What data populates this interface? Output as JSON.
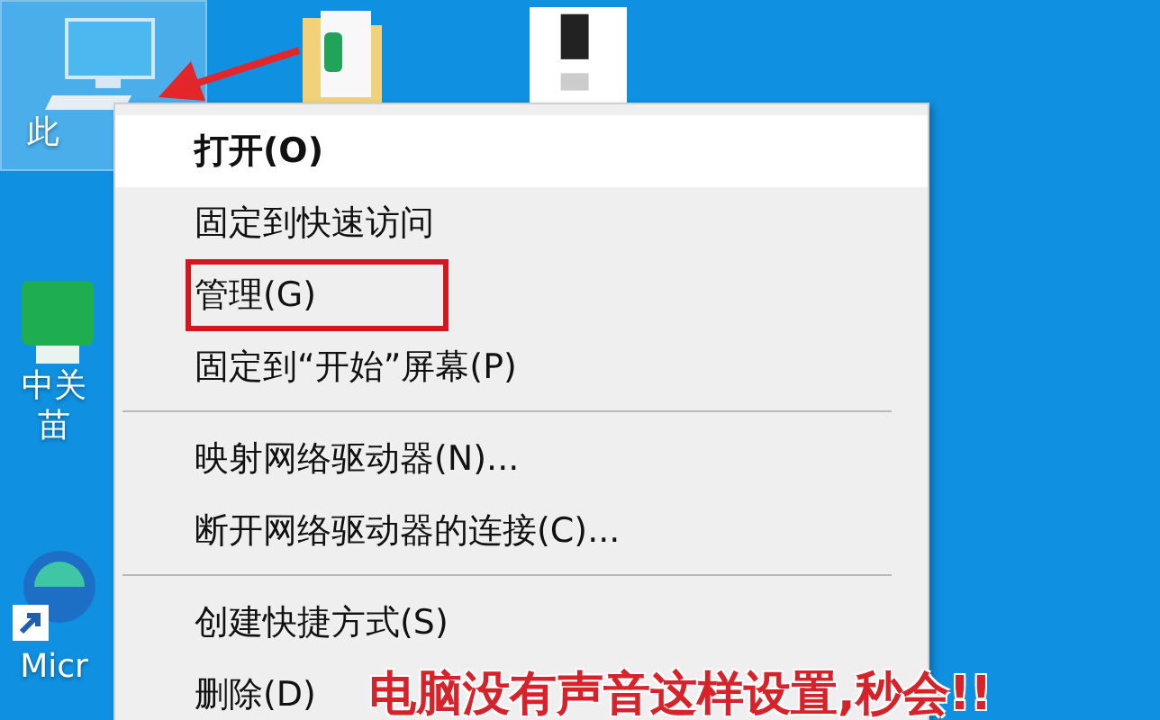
{
  "desktop_icons": [
    {
      "kind": "computer",
      "lines": [
        "此"
      ],
      "selected": true
    },
    {
      "kind": "folder",
      "selected": false
    },
    {
      "kind": "document",
      "selected": false
    },
    {
      "kind": "app",
      "lines": [
        "中关",
        "苗"
      ],
      "selected": false
    },
    {
      "kind": "browser",
      "lines": [
        "Micr"
      ],
      "selected": false
    }
  ],
  "context_menu": {
    "items": [
      {
        "kind": "item",
        "label": "打开(O)",
        "default": true,
        "selected": true,
        "marked": false
      },
      {
        "kind": "item",
        "label": "固定到快速访问",
        "default": false,
        "selected": false,
        "marked": false
      },
      {
        "kind": "item",
        "label": "管理(G)",
        "default": false,
        "selected": false,
        "marked": true
      },
      {
        "kind": "item",
        "label": "固定到“开始”屏幕(P)",
        "default": false,
        "selected": false,
        "marked": false
      },
      {
        "kind": "separator"
      },
      {
        "kind": "item",
        "label": "映射网络驱动器(N)...",
        "default": false,
        "selected": false,
        "marked": false
      },
      {
        "kind": "item",
        "label": "断开网络驱动器的连接(C)...",
        "default": false,
        "selected": false,
        "marked": false
      },
      {
        "kind": "separator"
      },
      {
        "kind": "item",
        "label": "创建快捷方式(S)",
        "default": false,
        "selected": false,
        "marked": false
      },
      {
        "kind": "item",
        "label": "删除(D)",
        "default": false,
        "selected": false,
        "marked": false
      }
    ]
  },
  "caption": "电脑没有声音这样设置,秒会!!"
}
